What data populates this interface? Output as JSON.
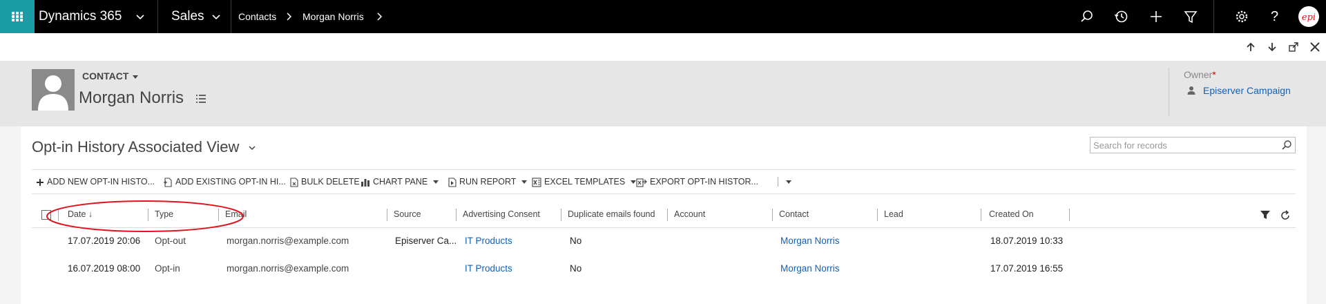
{
  "topnav": {
    "app_name": "Dynamics 365",
    "area": "Sales",
    "breadcrumb": [
      "Contacts",
      "Morgan Norris"
    ],
    "icons": [
      "search-icon",
      "recent-icon",
      "new-icon",
      "filter-icon",
      "settings-icon",
      "help-icon"
    ]
  },
  "record_toolbar": {
    "icons": [
      "arrow-up-icon",
      "arrow-down-icon",
      "popout-icon",
      "close-icon"
    ]
  },
  "header": {
    "entity": "CONTACT",
    "name": "Morgan Norris",
    "owner_label": "Owner",
    "owner_required": "*",
    "owner_value": "Episerver Campaign"
  },
  "view": {
    "title": "Opt-in History Associated View",
    "search_placeholder": "Search for records"
  },
  "commands": [
    {
      "label": "ADD NEW OPT-IN HISTO...",
      "icon": "plus-icon",
      "dropdown": false
    },
    {
      "label": "ADD EXISTING OPT-IN HI...",
      "icon": "add-existing-icon",
      "dropdown": false
    },
    {
      "label": "BULK DELETE",
      "icon": "bulk-delete-icon",
      "dropdown": false
    },
    {
      "label": "CHART PANE",
      "icon": "chart-icon",
      "dropdown": true
    },
    {
      "label": "RUN REPORT",
      "icon": "report-icon",
      "dropdown": true
    },
    {
      "label": "EXCEL TEMPLATES",
      "icon": "excel-icon",
      "dropdown": true
    },
    {
      "label": "EXPORT OPT-IN HISTOR...",
      "icon": "export-icon",
      "dropdown": false
    }
  ],
  "grid": {
    "columns": [
      "Date ↓",
      "Type",
      "Email",
      "Source",
      "Advertising Consent",
      "Duplicate emails found",
      "Account",
      "Contact",
      "Lead",
      "Created On"
    ],
    "rows": [
      {
        "date": "17.07.2019 20:06",
        "type": "Opt-out",
        "email": "morgan.norris@example.com",
        "source": "Episerver Ca...",
        "consent": "IT Products",
        "duplicate": "No",
        "account": "",
        "contact": "Morgan Norris",
        "lead": "",
        "created": "18.07.2019 10:33"
      },
      {
        "date": "16.07.2019 08:00",
        "type": "Opt-in",
        "email": "morgan.norris@example.com",
        "source": "",
        "consent": "IT Products",
        "duplicate": "No",
        "account": "",
        "contact": "Morgan Norris",
        "lead": "",
        "created": "17.07.2019 16:55"
      }
    ]
  },
  "colors": {
    "accent": "#1a9ba6",
    "link": "#1160b7",
    "annotation": "#e0141e"
  }
}
